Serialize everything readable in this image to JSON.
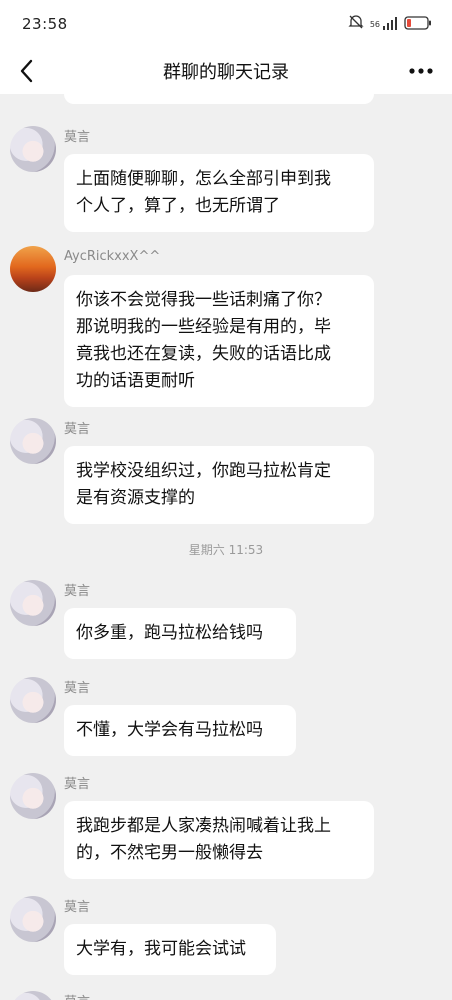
{
  "status": {
    "time": "23:58",
    "signal": "56",
    "battery_icon": "battery-icon"
  },
  "nav": {
    "title": "群聊的聊天记录",
    "back_icon": "chevron-left-icon",
    "more_icon": "more-horizontal-icon"
  },
  "messages": [
    {
      "sender": "莫言",
      "text_lines": [
        "上面随便聊聊，怎么全部引申到我",
        "个人了，算了，也无所谓了"
      ]
    },
    {
      "sender": "AycRickxxX^^",
      "text_lines": [
        "你该不会觉得我一些话刺痛了你？",
        "那说明我的一些经验是有用的，毕",
        "竟我也还在复读，失败的话语比成",
        "功的话语更耐听"
      ]
    },
    {
      "sender": "莫言",
      "text_lines": [
        "我学校没组织过，你跑马拉松肯定",
        "是有资源支撑的"
      ]
    },
    {
      "sender": "莫言",
      "text_lines": [
        "你多重，跑马拉松给钱吗"
      ]
    },
    {
      "sender": "莫言",
      "text_lines": [
        "不懂，大学会有马拉松吗"
      ]
    },
    {
      "sender": "莫言",
      "text_lines": [
        "我跑步都是人家凑热闹喊着让我上",
        "的，不然宅男一般懒得去"
      ]
    },
    {
      "sender": "莫言",
      "text_lines": [
        "大学有，我可能会试试"
      ]
    },
    {
      "sender": "莫言",
      "text_lines": []
    }
  ],
  "timestamp": "星期六 11:53"
}
